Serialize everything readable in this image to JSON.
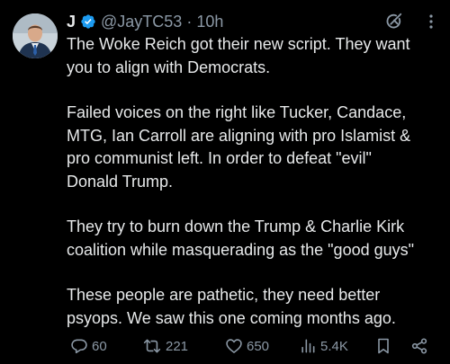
{
  "author": {
    "display_name": "J",
    "handle": "@JayTC53",
    "separator": "·",
    "time": "10h"
  },
  "tweet": {
    "paragraphs": [
      [
        "The Woke Reich got their new script. They want",
        "you to align with Democrats."
      ],
      [
        "Failed voices on the right like Tucker, Candace,",
        "MTG, Ian Carroll are aligning with pro Islamist &",
        "pro communist left. In order to defeat \"evil\"",
        "Donald Trump."
      ],
      [
        "They try to burn down the Trump & Charlie Kirk",
        "coalition while masquerading as the \"good guys\""
      ],
      [
        "These people are pathetic, they need better",
        "psyops. We saw this one coming months ago."
      ]
    ]
  },
  "actions": {
    "replies": "60",
    "reposts": "221",
    "likes": "650",
    "views": "5.4K"
  },
  "icons": {
    "verified": "verified-badge-icon",
    "grok": "grok-icon",
    "more": "more-options-icon",
    "reply": "reply-icon",
    "repost": "repost-icon",
    "like": "heart-icon",
    "views": "views-icon",
    "bookmark": "bookmark-icon",
    "share": "share-icon"
  },
  "colors": {
    "background": "#000000",
    "text": "#e7e9ea",
    "secondary": "#8b98a5",
    "verified": "#1d9bf0"
  }
}
